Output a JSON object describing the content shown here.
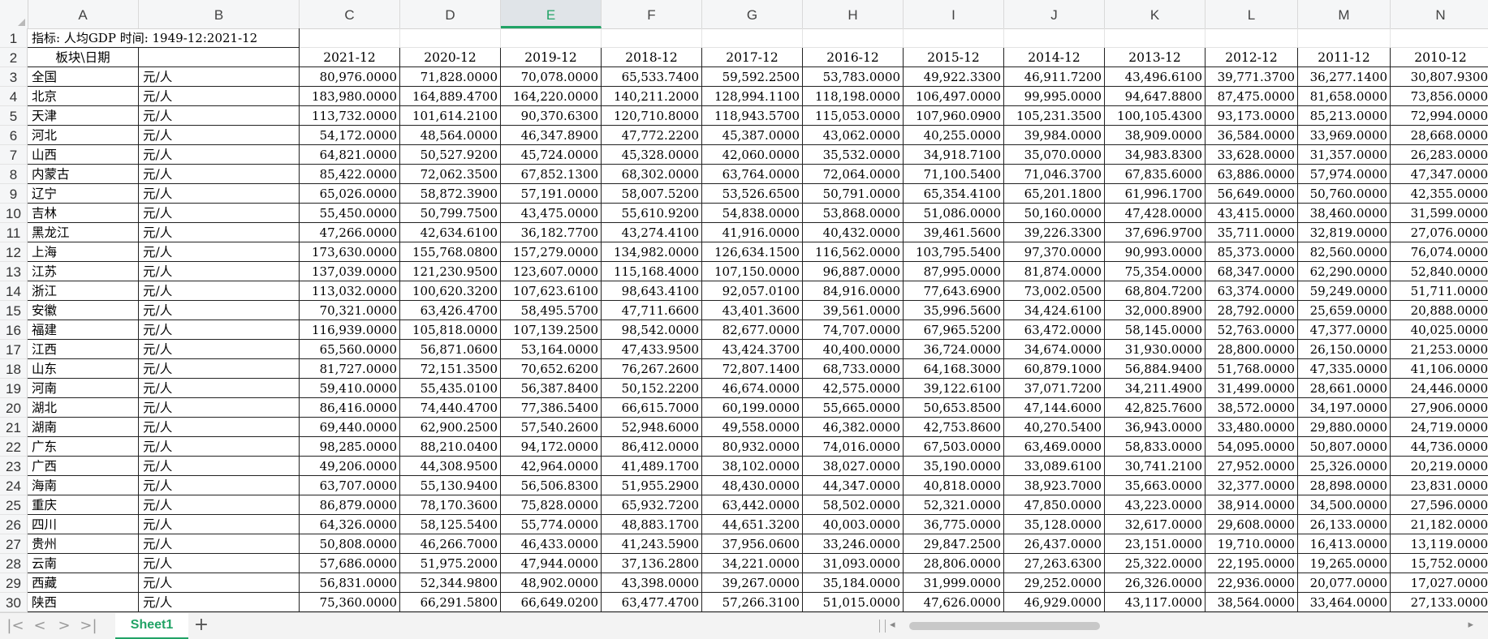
{
  "columns": [
    "A",
    "B",
    "C",
    "D",
    "E",
    "F",
    "G",
    "H",
    "I",
    "J",
    "K",
    "L",
    "M",
    "N"
  ],
  "active_column": "E",
  "row_numbers": [
    "1",
    "2",
    "3",
    "4",
    "5",
    "6",
    "7",
    "8",
    "9",
    "10",
    "11",
    "12",
    "13",
    "14",
    "15",
    "16",
    "17",
    "18",
    "19",
    "20",
    "21",
    "22",
    "23",
    "24",
    "25",
    "26",
    "27",
    "28",
    "29",
    "30"
  ],
  "row1": {
    "a": "指标: 人均GDP  时间: 1949-12:2021-12"
  },
  "row2": {
    "a": "板块\\日期",
    "b": "",
    "dates": [
      "2021-12",
      "2020-12",
      "2019-12",
      "2018-12",
      "2017-12",
      "2016-12",
      "2015-12",
      "2014-12",
      "2013-12",
      "2012-12",
      "2011-12",
      "2010-12"
    ]
  },
  "unit": "元/人",
  "rows": [
    {
      "region": "全国",
      "unit": "元/人",
      "values": [
        "80,976.0000",
        "71,828.0000",
        "70,078.0000",
        "65,533.7400",
        "59,592.2500",
        "53,783.0000",
        "49,922.3300",
        "46,911.7200",
        "43,496.6100",
        "39,771.3700",
        "36,277.1400",
        "30,807.9300"
      ]
    },
    {
      "region": "北京",
      "unit": "元/人",
      "values": [
        "183,980.0000",
        "164,889.4700",
        "164,220.0000",
        "140,211.2000",
        "128,994.1100",
        "118,198.0000",
        "106,497.0000",
        "99,995.0000",
        "94,647.8800",
        "87,475.0000",
        "81,658.0000",
        "73,856.0000"
      ]
    },
    {
      "region": "天津",
      "unit": "元/人",
      "values": [
        "113,732.0000",
        "101,614.2100",
        "90,370.6300",
        "120,710.8000",
        "118,943.5700",
        "115,053.0000",
        "107,960.0900",
        "105,231.3500",
        "100,105.4300",
        "93,173.0000",
        "85,213.0000",
        "72,994.0000"
      ]
    },
    {
      "region": "河北",
      "unit": "元/人",
      "values": [
        "54,172.0000",
        "48,564.0000",
        "46,347.8900",
        "47,772.2200",
        "45,387.0000",
        "43,062.0000",
        "40,255.0000",
        "39,984.0000",
        "38,909.0000",
        "36,584.0000",
        "33,969.0000",
        "28,668.0000"
      ]
    },
    {
      "region": "山西",
      "unit": "元/人",
      "values": [
        "64,821.0000",
        "50,527.9200",
        "45,724.0000",
        "45,328.0000",
        "42,060.0000",
        "35,532.0000",
        "34,918.7100",
        "35,070.0000",
        "34,983.8300",
        "33,628.0000",
        "31,357.0000",
        "26,283.0000"
      ]
    },
    {
      "region": "内蒙古",
      "unit": "元/人",
      "values": [
        "85,422.0000",
        "72,062.3500",
        "67,852.1300",
        "68,302.0000",
        "63,764.0000",
        "72,064.0000",
        "71,100.5400",
        "71,046.3700",
        "67,835.6000",
        "63,886.0000",
        "57,974.0000",
        "47,347.0000"
      ]
    },
    {
      "region": "辽宁",
      "unit": "元/人",
      "values": [
        "65,026.0000",
        "58,872.3900",
        "57,191.0000",
        "58,007.5200",
        "53,526.6500",
        "50,791.0000",
        "65,354.4100",
        "65,201.1800",
        "61,996.1700",
        "56,649.0000",
        "50,760.0000",
        "42,355.0000"
      ]
    },
    {
      "region": "吉林",
      "unit": "元/人",
      "values": [
        "55,450.0000",
        "50,799.7500",
        "43,475.0000",
        "55,610.9200",
        "54,838.0000",
        "53,868.0000",
        "51,086.0000",
        "50,160.0000",
        "47,428.0000",
        "43,415.0000",
        "38,460.0000",
        "31,599.0000"
      ]
    },
    {
      "region": "黑龙江",
      "unit": "元/人",
      "values": [
        "47,266.0000",
        "42,634.6100",
        "36,182.7700",
        "43,274.4100",
        "41,916.0000",
        "40,432.0000",
        "39,461.5600",
        "39,226.3300",
        "37,696.9700",
        "35,711.0000",
        "32,819.0000",
        "27,076.0000"
      ]
    },
    {
      "region": "上海",
      "unit": "元/人",
      "values": [
        "173,630.0000",
        "155,768.0800",
        "157,279.0000",
        "134,982.0000",
        "126,634.1500",
        "116,562.0000",
        "103,795.5400",
        "97,370.0000",
        "90,993.0000",
        "85,373.0000",
        "82,560.0000",
        "76,074.0000"
      ]
    },
    {
      "region": "江苏",
      "unit": "元/人",
      "values": [
        "137,039.0000",
        "121,230.9500",
        "123,607.0000",
        "115,168.4000",
        "107,150.0000",
        "96,887.0000",
        "87,995.0000",
        "81,874.0000",
        "75,354.0000",
        "68,347.0000",
        "62,290.0000",
        "52,840.0000"
      ]
    },
    {
      "region": "浙江",
      "unit": "元/人",
      "values": [
        "113,032.0000",
        "100,620.3200",
        "107,623.6100",
        "98,643.4100",
        "92,057.0100",
        "84,916.0000",
        "77,643.6900",
        "73,002.0500",
        "68,804.7200",
        "63,374.0000",
        "59,249.0000",
        "51,711.0000"
      ]
    },
    {
      "region": "安徽",
      "unit": "元/人",
      "values": [
        "70,321.0000",
        "63,426.4700",
        "58,495.5700",
        "47,711.6600",
        "43,401.3600",
        "39,561.0000",
        "35,996.5600",
        "34,424.6100",
        "32,000.8900",
        "28,792.0000",
        "25,659.0000",
        "20,888.0000"
      ]
    },
    {
      "region": "福建",
      "unit": "元/人",
      "values": [
        "116,939.0000",
        "105,818.0000",
        "107,139.2500",
        "98,542.0000",
        "82,677.0000",
        "74,707.0000",
        "67,965.5200",
        "63,472.0000",
        "58,145.0000",
        "52,763.0000",
        "47,377.0000",
        "40,025.0000"
      ]
    },
    {
      "region": "江西",
      "unit": "元/人",
      "values": [
        "65,560.0000",
        "56,871.0600",
        "53,164.0000",
        "47,433.9500",
        "43,424.3700",
        "40,400.0000",
        "36,724.0000",
        "34,674.0000",
        "31,930.0000",
        "28,800.0000",
        "26,150.0000",
        "21,253.0000"
      ]
    },
    {
      "region": "山东",
      "unit": "元/人",
      "values": [
        "81,727.0000",
        "72,151.3500",
        "70,652.6200",
        "76,267.2600",
        "72,807.1400",
        "68,733.0000",
        "64,168.3000",
        "60,879.1000",
        "56,884.9400",
        "51,768.0000",
        "47,335.0000",
        "41,106.0000"
      ]
    },
    {
      "region": "河南",
      "unit": "元/人",
      "values": [
        "59,410.0000",
        "55,435.0100",
        "56,387.8400",
        "50,152.2200",
        "46,674.0000",
        "42,575.0000",
        "39,122.6100",
        "37,071.7200",
        "34,211.4900",
        "31,499.0000",
        "28,661.0000",
        "24,446.0000"
      ]
    },
    {
      "region": "湖北",
      "unit": "元/人",
      "values": [
        "86,416.0000",
        "74,440.4700",
        "77,386.5400",
        "66,615.7000",
        "60,199.0000",
        "55,665.0000",
        "50,653.8500",
        "47,144.6000",
        "42,825.7600",
        "38,572.0000",
        "34,197.0000",
        "27,906.0000"
      ]
    },
    {
      "region": "湖南",
      "unit": "元/人",
      "values": [
        "69,440.0000",
        "62,900.2500",
        "57,540.2600",
        "52,948.6000",
        "49,558.0000",
        "46,382.0000",
        "42,753.8600",
        "40,270.5400",
        "36,943.0000",
        "33,480.0000",
        "29,880.0000",
        "24,719.0000"
      ]
    },
    {
      "region": "广东",
      "unit": "元/人",
      "values": [
        "98,285.0000",
        "88,210.0400",
        "94,172.0000",
        "86,412.0000",
        "80,932.0000",
        "74,016.0000",
        "67,503.0000",
        "63,469.0000",
        "58,833.0000",
        "54,095.0000",
        "50,807.0000",
        "44,736.0000"
      ]
    },
    {
      "region": "广西",
      "unit": "元/人",
      "values": [
        "49,206.0000",
        "44,308.9500",
        "42,964.0000",
        "41,489.1700",
        "38,102.0000",
        "38,027.0000",
        "35,190.0000",
        "33,089.6100",
        "30,741.2100",
        "27,952.0000",
        "25,326.0000",
        "20,219.0000"
      ]
    },
    {
      "region": "海南",
      "unit": "元/人",
      "values": [
        "63,707.0000",
        "55,130.9400",
        "56,506.8300",
        "51,955.2900",
        "48,430.0000",
        "44,347.0000",
        "40,818.0000",
        "38,923.7000",
        "35,663.0000",
        "32,377.0000",
        "28,898.0000",
        "23,831.0000"
      ]
    },
    {
      "region": "重庆",
      "unit": "元/人",
      "values": [
        "86,879.0000",
        "78,170.3600",
        "75,828.0000",
        "65,932.7200",
        "63,442.0000",
        "58,502.0000",
        "52,321.0000",
        "47,850.0000",
        "43,223.0000",
        "38,914.0000",
        "34,500.0000",
        "27,596.0000"
      ]
    },
    {
      "region": "四川",
      "unit": "元/人",
      "values": [
        "64,326.0000",
        "58,125.5400",
        "55,774.0000",
        "48,883.1700",
        "44,651.3200",
        "40,003.0000",
        "36,775.0000",
        "35,128.0000",
        "32,617.0000",
        "29,608.0000",
        "26,133.0000",
        "21,182.0000"
      ]
    },
    {
      "region": "贵州",
      "unit": "元/人",
      "values": [
        "50,808.0000",
        "46,266.7000",
        "46,433.0000",
        "41,243.5900",
        "37,956.0600",
        "33,246.0000",
        "29,847.2500",
        "26,437.0000",
        "23,151.0000",
        "19,710.0000",
        "16,413.0000",
        "13,119.0000"
      ]
    },
    {
      "region": "云南",
      "unit": "元/人",
      "values": [
        "57,686.0000",
        "51,975.2000",
        "47,944.0000",
        "37,136.2800",
        "34,221.0000",
        "31,093.0000",
        "28,806.0000",
        "27,263.6300",
        "25,322.0000",
        "22,195.0000",
        "19,265.0000",
        "15,752.0000"
      ]
    },
    {
      "region": "西藏",
      "unit": "元/人",
      "values": [
        "56,831.0000",
        "52,344.9800",
        "48,902.0000",
        "43,398.0000",
        "39,267.0000",
        "35,184.0000",
        "31,999.0000",
        "29,252.0000",
        "26,326.0000",
        "22,936.0000",
        "20,077.0000",
        "17,027.0000"
      ]
    },
    {
      "region": "陕西",
      "unit": "元/人",
      "values": [
        "75,360.0000",
        "66,291.5800",
        "66,649.0200",
        "63,477.4700",
        "57,266.3100",
        "51,015.0000",
        "47,626.0000",
        "46,929.0000",
        "43,117.0000",
        "38,564.0000",
        "33,464.0000",
        "27,133.0000"
      ]
    }
  ],
  "sheet_tab": "Sheet1",
  "add_sheet_label": "+",
  "nav": {
    "first": "|<",
    "prev": "<",
    "next": ">",
    "last": ">|"
  }
}
